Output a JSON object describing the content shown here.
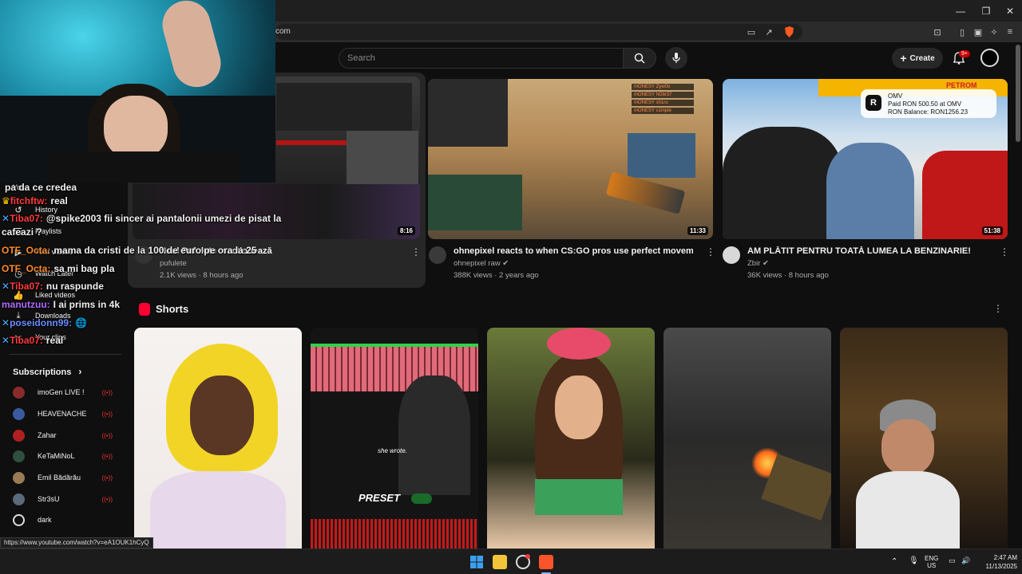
{
  "browser": {
    "url_fragment": "com",
    "status_url": "https://www.youtube.com/watch?v=eA1OUK1hCyQ"
  },
  "header": {
    "search_placeholder": "Search",
    "create_label": "Create",
    "notification_count": "9+"
  },
  "sidebar": {
    "items": [
      {
        "label": "You"
      },
      {
        "label": "History"
      },
      {
        "label": "Playlists"
      },
      {
        "label": "Your videos"
      },
      {
        "label": "Watch Later"
      },
      {
        "label": "Liked videos"
      },
      {
        "label": "Downloads"
      },
      {
        "label": "Your clips"
      }
    ],
    "subscriptions_title": "Subscriptions",
    "subscriptions": [
      {
        "name": "imoGen LIVE !",
        "live": true,
        "color": "#8a2b2b"
      },
      {
        "name": "HEAVENACHE",
        "live": true,
        "color": "#3a5aa0"
      },
      {
        "name": "Zahar",
        "live": true,
        "color": "#b02020"
      },
      {
        "name": "KeTaMiNoL",
        "live": true,
        "color": "#2f4f3f"
      },
      {
        "name": "Emil Bădărău",
        "live": true,
        "color": "#9a7a55"
      },
      {
        "name": "Str3sU",
        "live": true,
        "color": "#5a6a7a"
      },
      {
        "name": "dark",
        "live": false,
        "color": "#dddddd"
      }
    ]
  },
  "chat": [
    {
      "user": "",
      "text": "pa da ce credea",
      "user_color": "#ffffff"
    },
    {
      "user": "fitchftw:",
      "text": "real",
      "user_color": "#ff3b3b"
    },
    {
      "user": "Tiba07:",
      "text": "@spike2003 fii sincer ai pantalonii umezi de pisat la",
      "user_color": "#ff3b3b"
    },
    {
      "user": "",
      "text": "cafeazi ?",
      "user_color": "#ffffff"
    },
    {
      "user": "OTF_Octa:",
      "text": "mama da cristi de la 100 de euro pe ora la 25",
      "user_color": "#ff8c2a"
    },
    {
      "user": "OTF_Octa:",
      "text": "sa mi bag pla",
      "user_color": "#ff8c2a"
    },
    {
      "user": "Tiba07:",
      "text": "nu raspunde",
      "user_color": "#ff3b3b"
    },
    {
      "user": "manutzuu:",
      "text": "I ai prims in 4k",
      "user_color": "#b06bff"
    },
    {
      "user": "poseidonn99:",
      "text": "🌐",
      "user_color": "#6a8cff"
    },
    {
      "user": "Tiba07:",
      "text": "real",
      "user_color": "#ff3b3b"
    }
  ],
  "videos": [
    {
      "title": "Noul Pufulete reactionează",
      "channel": "pufulete",
      "meta": "2.1K views · 8 hours ago",
      "duration": "8:16"
    },
    {
      "title": "ohnepixel reacts to when CS:GO pros use perfect movement",
      "channel": "ohnepixel raw",
      "meta": "388K views · 2 years ago",
      "duration": "11:33",
      "verified": true
    },
    {
      "title": "AM PLĂTIT PENTRU TOATĂ LUMEA LA BENZINARIE!",
      "channel": "Zbir",
      "meta": "36K views · 8 hours ago",
      "duration": "51:38",
      "verified": true
    }
  ],
  "thumb_overlay": {
    "brand": "OMV",
    "line1": "Paid RON 500.50 at OMV",
    "line2": "RON Balance: RON1256.23",
    "station": "PETROM",
    "shorts2_caption": "she wrote.",
    "shorts2_preset": "PRESET"
  },
  "killfeed": [
    "mONESY Zyw0o",
    "mONESY hObr37",
    "mONESY sh1ro",
    "mONESY s1mple"
  ],
  "shorts": {
    "title": "Shorts"
  },
  "taskbar": {
    "lang_1": "ENG",
    "lang_2": "US",
    "time": "2:47 AM",
    "date": "11/13/2025"
  }
}
